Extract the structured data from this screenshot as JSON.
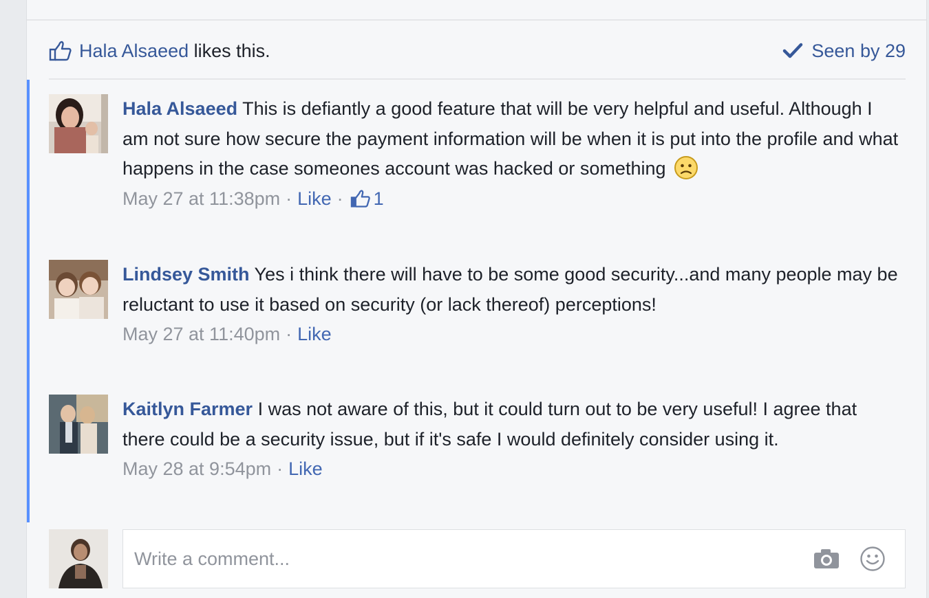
{
  "likes": {
    "liker": "Hala Alsaeed",
    "suffix": " likes this.",
    "seen": "Seen by 29"
  },
  "comments": [
    {
      "author": "Hala Alsaeed",
      "text": "This is defiantly a good feature that will be very helpful and useful. Although I am not sure how secure the payment information will be when it is put into the profile and what happens in the case someones account was hacked or something",
      "time": "May 27 at 11:38pm",
      "like_label": "Like",
      "like_count": "1",
      "emoji": "frown-emoji"
    },
    {
      "author": "Lindsey Smith",
      "text": "Yes i think there will have to be some good security...and many people may be reluctant to use it based on security (or lack thereof) perceptions!",
      "time": "May 27 at 11:40pm",
      "like_label": "Like"
    },
    {
      "author": "Kaitlyn Farmer",
      "text": "I was not aware of this, but it could turn out to be very useful! I agree that there could be a security issue, but if it's safe I would definitely consider using it.",
      "time": "May 28 at 9:54pm",
      "like_label": "Like"
    }
  ],
  "composer": {
    "placeholder": "Write a comment...",
    "camera_icon": "camera-icon",
    "emoji_icon": "smiley-icon"
  },
  "colors": {
    "link": "#365899",
    "accent_bar": "#5890ff",
    "meta": "#90949c",
    "background": "#f6f7f9"
  }
}
